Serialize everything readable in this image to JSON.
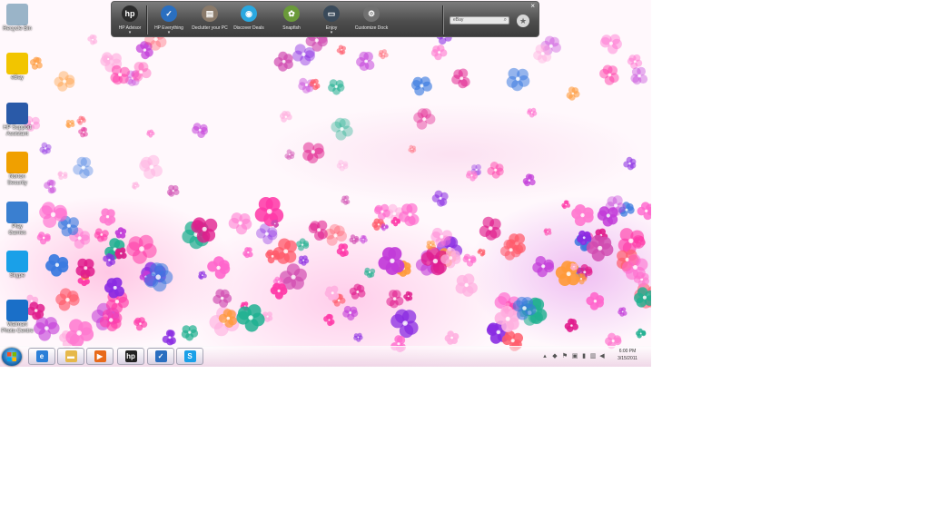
{
  "desktop_icons": [
    {
      "label": "Recycle Bin",
      "icon": "recycle-bin-icon",
      "color": "#9ab4c8"
    },
    {
      "label": "eBay",
      "icon": "ebay-icon",
      "color": "#f2c500"
    },
    {
      "label": "HP Support\nAssistant",
      "icon": "hp-support-icon",
      "color": "#2a5aa8"
    },
    {
      "label": "Norton\nSecurity",
      "icon": "globe-icon",
      "color": "#f0a000"
    },
    {
      "label": "Play\nGames",
      "icon": "games-icon",
      "color": "#3a7fd0"
    },
    {
      "label": "Skype",
      "icon": "skype-icon",
      "color": "#1aa0e8"
    },
    {
      "label": "Walmart\nPhoto Centre",
      "icon": "walmart-icon",
      "color": "#1a6fc8"
    }
  ],
  "dock": {
    "items": [
      {
        "label": "HP Advisor",
        "icon": "hp-logo-icon",
        "color": "#2b2b2b",
        "glyph": "hp",
        "caret": true
      },
      {
        "label": "HP Everything",
        "icon": "checkmark-icon",
        "color": "#2a6fc0",
        "glyph": "✓",
        "caret": true
      },
      {
        "label": "Declutter your PC",
        "icon": "suitcase-icon",
        "color": "#8a7a6a",
        "glyph": "▤",
        "caret": false
      },
      {
        "label": "Discover Deals",
        "icon": "deals-icon",
        "color": "#2aa8e0",
        "glyph": "◉",
        "caret": false
      },
      {
        "label": "Snapfish",
        "icon": "snapfish-icon",
        "color": "#6a9a3a",
        "glyph": "✿",
        "caret": false
      },
      {
        "label": "Enjoy",
        "icon": "tv-icon",
        "color": "#3a4a5a",
        "glyph": "▭",
        "caret": true
      },
      {
        "label": "Customize Dock",
        "icon": "gear-icon",
        "color": "#707070",
        "glyph": "⚙",
        "caret": false
      }
    ],
    "search_text": "eBay",
    "close_glyph": "×",
    "fav_glyph": "★"
  },
  "taskbar": {
    "buttons": [
      {
        "name": "ie-icon",
        "glyph": "e",
        "color": "#2a7fd8"
      },
      {
        "name": "folder-icon",
        "glyph": "▬",
        "color": "#e6b84a"
      },
      {
        "name": "media-player-icon",
        "glyph": "▶",
        "color": "#e86a1a"
      },
      {
        "name": "hp-logo-icon",
        "glyph": "hp",
        "color": "#222222"
      },
      {
        "name": "checkmark-icon",
        "glyph": "✓",
        "color": "#2a6fc0"
      },
      {
        "name": "skype-icon",
        "glyph": "S",
        "color": "#1aa0e8"
      }
    ],
    "tray_icons": [
      {
        "name": "show-hidden-icon",
        "glyph": "▴"
      },
      {
        "name": "norton-icon",
        "glyph": "◆"
      },
      {
        "name": "flag-icon",
        "glyph": "⚑"
      },
      {
        "name": "display-icon",
        "glyph": "▣"
      },
      {
        "name": "battery-icon",
        "glyph": "▮"
      },
      {
        "name": "network-icon",
        "glyph": "▥"
      },
      {
        "name": "volume-icon",
        "glyph": "◀"
      }
    ],
    "clock_time": "6:00 PM",
    "clock_date": "3/15/2011"
  }
}
